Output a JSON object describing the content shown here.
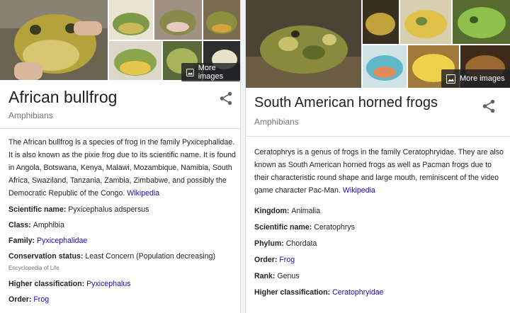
{
  "left_card": {
    "title": "African bullfrog",
    "subtitle": "Amphibians",
    "more_images": "More images",
    "description": "The African bullfrog is a species of frog in the family Pyxicephalidae. It is also known as the pixie frog due to its scientific name. It is found in Angola, Botswana, Kenya, Malawi, Mozambique, Namibia, South Africa, Swaziland, Tanzania, Zambia, Zimbabwe, and possibly the Democratic Republic of the Congo.",
    "source_link": "Wikipedia",
    "facts": [
      {
        "label": "Scientific name:",
        "value": "Pyxicephalus adspersus",
        "link": false
      },
      {
        "label": "Class:",
        "value": "Amphibia",
        "link": false
      },
      {
        "label": "Family:",
        "value": "Pyxicephalidae",
        "link": true
      },
      {
        "label": "Conservation status:",
        "value": "Least Concern (Population decreasing)",
        "link": false,
        "source": "Encyclopedia of Life"
      },
      {
        "label": "Higher classification:",
        "value": "Pyxicephalus",
        "link": true
      },
      {
        "label": "Order:",
        "value": "Frog",
        "link": true
      }
    ]
  },
  "right_card": {
    "title": "South American horned frogs",
    "subtitle": "Amphibians",
    "more_images": "More images",
    "description": "Ceratophrys is a genus of frogs in the family Ceratophryidae. They are also known as South American horned frogs as well as Pacman frogs due to their characteristic round shape and large mouth, reminiscent of the video game character Pac-Man.",
    "source_link": "Wikipedia",
    "facts": [
      {
        "label": "Kingdom:",
        "value": "Animalia",
        "link": false
      },
      {
        "label": "Scientific name:",
        "value": "Ceratophrys",
        "link": false
      },
      {
        "label": "Phylum:",
        "value": "Chordata",
        "link": false
      },
      {
        "label": "Order:",
        "value": "Frog",
        "link": true
      },
      {
        "label": "Rank:",
        "value": "Genus",
        "link": false
      },
      {
        "label": "Higher classification:",
        "value": "Ceratophryidae",
        "link": true
      }
    ]
  },
  "colors": {
    "link": "#1a0dab",
    "subtitle": "#70757a",
    "divider": "#dadce0"
  },
  "icons": {
    "share": "share-icon",
    "images": "image-icon"
  }
}
